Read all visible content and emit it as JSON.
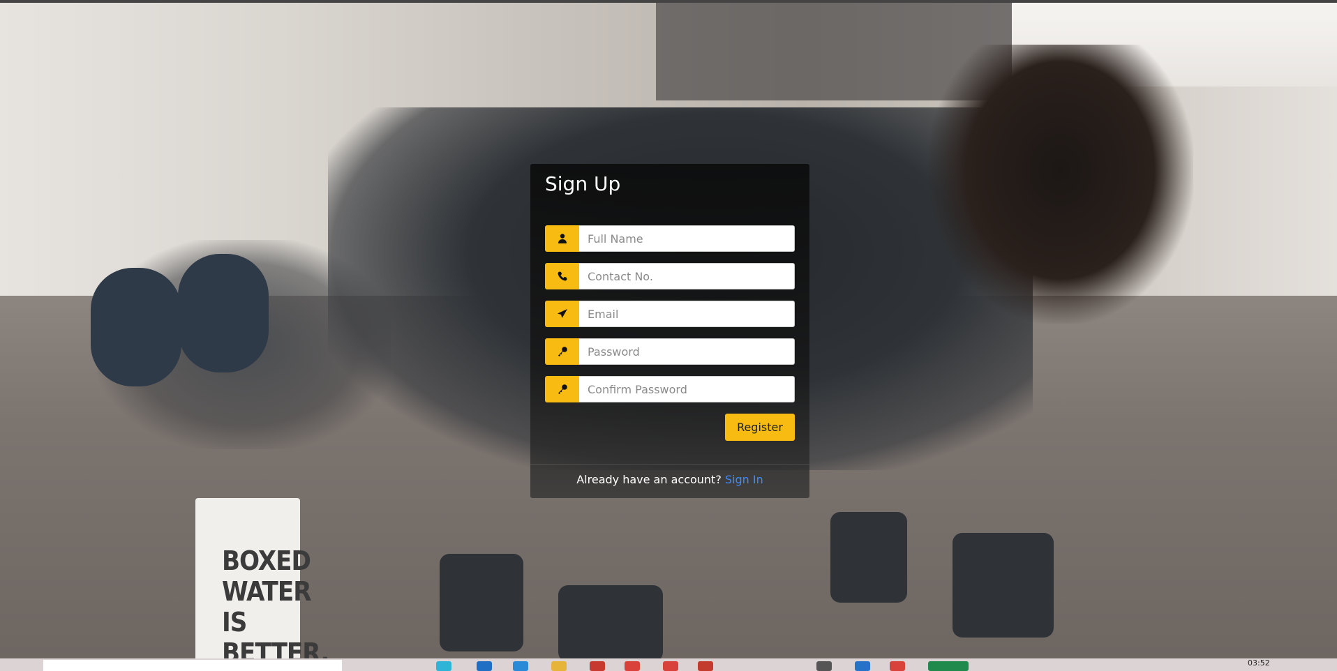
{
  "form": {
    "title": "Sign Up",
    "fields": [
      {
        "placeholder": "Full Name",
        "icon": "user-icon"
      },
      {
        "placeholder": "Contact No.",
        "icon": "phone-icon"
      },
      {
        "placeholder": "Email",
        "icon": "paper-plane-icon"
      },
      {
        "placeholder": "Password",
        "icon": "key-icon"
      },
      {
        "placeholder": "Confirm Password",
        "icon": "key-icon"
      }
    ],
    "register_label": "Register",
    "footer_text": "Already have an account?",
    "signin_label": "Sign In"
  },
  "background": {
    "carton_text": "BOXED WATER IS BETTER."
  },
  "taskbar": {
    "clock": "03:52"
  },
  "colors": {
    "accent": "#f7bb12",
    "link": "#3d8bfd",
    "panel": "#141414"
  }
}
